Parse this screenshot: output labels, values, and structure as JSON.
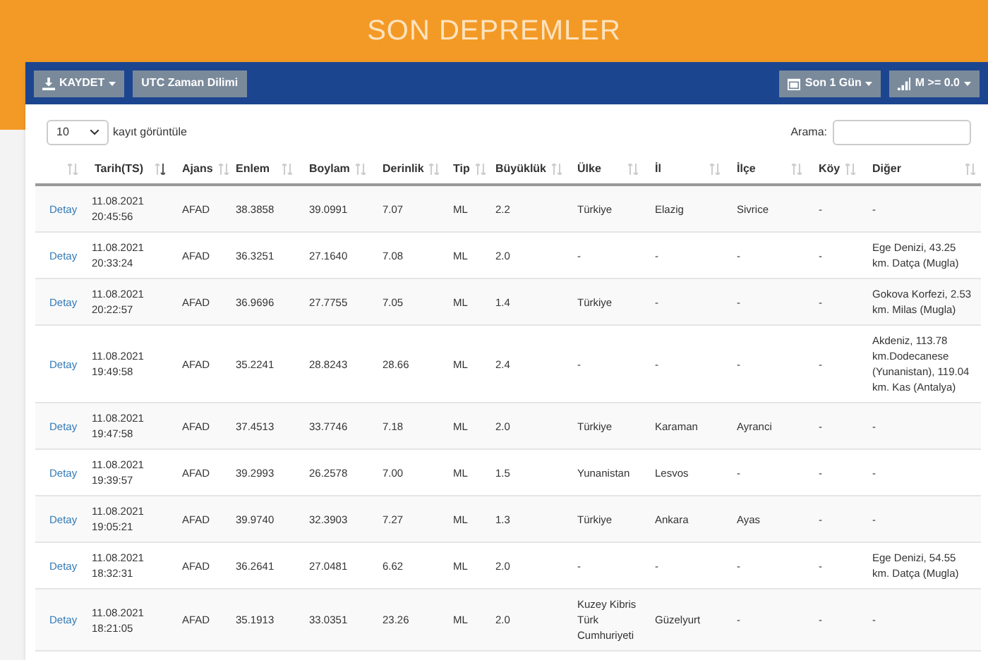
{
  "page_title": "SON DEPREMLER",
  "toolbar": {
    "left": [
      {
        "label": "KAYDET",
        "caret": true
      },
      {
        "label": "UTC Zaman Dilimi",
        "caret": false
      }
    ],
    "right": [
      {
        "label": "Son 1 Gün",
        "caret": true
      },
      {
        "label": "M >= 0.0",
        "caret": true
      }
    ]
  },
  "length_select": {
    "value": "10",
    "label": "kayıt görüntüle"
  },
  "search": {
    "label": "Arama:"
  },
  "table": {
    "columns": [
      {
        "sorted": false
      },
      {
        "label": "Tarih(TS)",
        "sorted": true
      },
      {
        "label": "Ajans",
        "sorted": false
      },
      {
        "label": "Enlem",
        "sorted": false
      },
      {
        "label": "Boylam",
        "sorted": false
      },
      {
        "label": "Derinlik",
        "sorted": false
      },
      {
        "label": "Tip",
        "sorted": false
      },
      {
        "label": "Büyüklük",
        "sorted": false
      },
      {
        "label": "Ülke",
        "sorted": false
      },
      {
        "label": "İl",
        "sorted": false
      },
      {
        "label": "İlçe",
        "sorted": false
      },
      {
        "label": "Köy",
        "sorted": false
      },
      {
        "label": "Diğer",
        "sorted": false
      }
    ],
    "rows": [
      [
        "Detay",
        "11.08.2021 20:45:56",
        "AFAD",
        "38.3858",
        "39.0991",
        "7.07",
        "ML",
        "2.2",
        "Türkiye",
        "Elazig",
        "Sivrice",
        "-",
        "-"
      ],
      [
        "Detay",
        "11.08.2021 20:33:24",
        "AFAD",
        "36.3251",
        "27.1640",
        "7.08",
        "ML",
        "2.0",
        "-",
        "-",
        "-",
        "-",
        "Ege Denizi, 43.25 km. Datça (Mugla)"
      ],
      [
        "Detay",
        "11.08.2021 20:22:57",
        "AFAD",
        "36.9696",
        "27.7755",
        "7.05",
        "ML",
        "1.4",
        "Türkiye",
        "-",
        "-",
        "-",
        "Gokova Korfezi, 2.53 km. Milas (Mugla)"
      ],
      [
        "Detay",
        "11.08.2021 19:49:58",
        "AFAD",
        "35.2241",
        "28.8243",
        "28.66",
        "ML",
        "2.4",
        "-",
        "-",
        "-",
        "-",
        "Akdeniz, 113.78 km.Dodecanese (Yunanistan), 119.04 km. Kas (Antalya)"
      ],
      [
        "Detay",
        "11.08.2021 19:47:58",
        "AFAD",
        "37.4513",
        "33.7746",
        "7.18",
        "ML",
        "2.0",
        "Türkiye",
        "Karaman",
        "Ayranci",
        "-",
        "-"
      ],
      [
        "Detay",
        "11.08.2021 19:39:57",
        "AFAD",
        "39.2993",
        "26.2578",
        "7.00",
        "ML",
        "1.5",
        "Yunanistan",
        "Lesvos",
        "-",
        "-",
        "-"
      ],
      [
        "Detay",
        "11.08.2021 19:05:21",
        "AFAD",
        "39.9740",
        "32.3903",
        "7.27",
        "ML",
        "1.3",
        "Türkiye",
        "Ankara",
        "Ayas",
        "-",
        "-"
      ],
      [
        "Detay",
        "11.08.2021 18:32:31",
        "AFAD",
        "36.2641",
        "27.0481",
        "6.62",
        "ML",
        "2.0",
        "-",
        "-",
        "-",
        "-",
        "Ege Denizi, 54.55 km. Datça (Mugla)"
      ],
      [
        "Detay",
        "11.08.2021 18:21:05",
        "AFAD",
        "35.1913",
        "33.0351",
        "23.26",
        "ML",
        "2.0",
        "Kuzey Kibris Türk Cumhuriyeti",
        "Güzelyurt",
        "-",
        "-",
        "-"
      ]
    ]
  }
}
